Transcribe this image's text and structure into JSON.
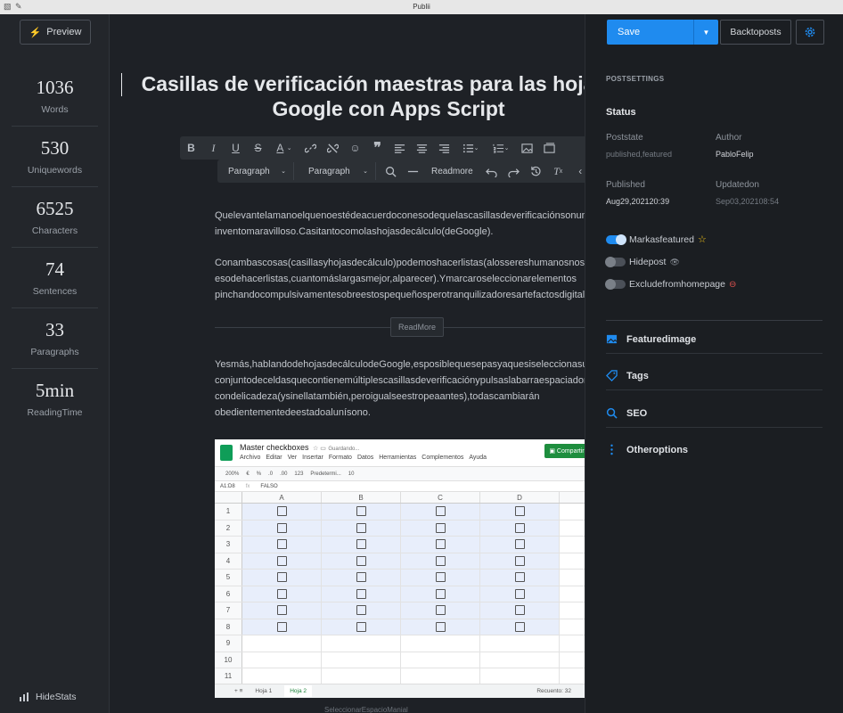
{
  "window": {
    "title": "Publii"
  },
  "stats": {
    "preview_label": "Preview",
    "items": [
      {
        "value": "1036",
        "label": "Words"
      },
      {
        "value": "530",
        "label": "Uniquewords"
      },
      {
        "value": "6525",
        "label": "Characters"
      },
      {
        "value": "74",
        "label": "Sentences"
      },
      {
        "value": "33",
        "label": "Paragraphs"
      },
      {
        "value": "5min",
        "label": "ReadingTime"
      }
    ],
    "hide_label": "HideStats"
  },
  "editor": {
    "title": "Casillas de verificación maestras para las hojas de Google con Apps Script",
    "toolbar": {
      "format1": "Paragraph",
      "format2": "Paragraph",
      "readmore": "Readmore"
    },
    "paragraphs": [
      [
        "Quelevantelamanoelquenoestédeacuerdoconesodequelascasillasdeverificaciónsonun",
        "inventomaravilloso.Casitantocomolashojasdecálculo(deGoogle)."
      ],
      [
        "Conambascosas(casillasyhojasdecálculo)podemoshacerlistas(alossereshumanosnosgusta",
        "esodehacerlistas,cuantomáslargasmejor,alparecer).Ymarcaroseleccionarelementos",
        "pinchandocompulsivamentesobreestospequeñosperotranquilizadoresartefactosdigitales."
      ],
      [
        "Yesmás,hablandodehojasdecálculodeGoogle,esposiblequesepasyaquesiseleccionasun",
        "conjuntodeceldasquecontienemúltiplescasillasdeverificaciónypulsaslabarraespaciadora",
        "condelicadeza(ysinellatambién,peroigualseestropeaantes),todascambiarán",
        "obedientementedeestadoalunísono."
      ]
    ],
    "readmore_pill": "ReadMore",
    "bottom_hint": "SeleccionarEspacioManial"
  },
  "sheet": {
    "doc_title": "Master checkboxes",
    "saving": "Guardando...",
    "menus": [
      "Archivo",
      "Editar",
      "Ver",
      "Insertar",
      "Formato",
      "Datos",
      "Herramientas",
      "Complementos",
      "Ayuda"
    ],
    "share": "Compartir",
    "tools": [
      "200%",
      "€",
      "%",
      ".0",
      ".00",
      "123",
      "Predetermi...",
      "10"
    ],
    "cell_ref": "A1:D8",
    "formula": "FALSO",
    "columns": [
      "A",
      "B",
      "C",
      "D"
    ],
    "rows": [
      "1",
      "2",
      "3",
      "4",
      "5",
      "6",
      "7",
      "8",
      "9",
      "10",
      "11"
    ],
    "tabs": [
      "Hoja 1",
      "Hoja 2"
    ],
    "count": "Recuento: 32"
  },
  "panel": {
    "save_label": "Save",
    "back_label": "Backtoposts",
    "section_title": "POSTSETTINGS",
    "status_heading": "Status",
    "meta": {
      "poststate_label": "Poststate",
      "poststate_value": "published,featured",
      "author_label": "Author",
      "author_value": "PabloFelip",
      "published_label": "Published",
      "published_value": "Aug29,202120:39",
      "updated_label": "Updatedon",
      "updated_value": "Sep03,202108:54"
    },
    "toggles": [
      {
        "label": "Markasfeatured",
        "on": true
      },
      {
        "label": "Hidepost",
        "on": false
      },
      {
        "label": "Excludefromhomepage",
        "on": false
      }
    ],
    "sections": [
      "Featuredimage",
      "Tags",
      "SEO",
      "Otheroptions"
    ]
  },
  "colors": {
    "accent": "#1f8bef",
    "background": "#1e2126",
    "panel": "#1b1e22"
  }
}
